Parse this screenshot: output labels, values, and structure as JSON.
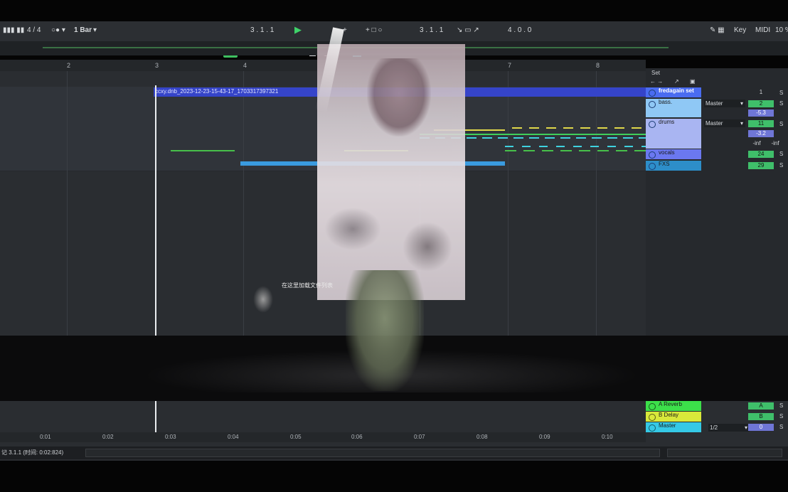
{
  "transport": {
    "time_sig": "4 / 4",
    "quantize": "1 Bar",
    "position": "3 . 1 . 1",
    "loop_start": "3 . 1 . 1",
    "loop_length": "4 . 0 . 0",
    "key_label": "Key",
    "midi_label": "MIDI",
    "cpu": "10 %"
  },
  "ruler": {
    "bars": [
      "2",
      "3",
      "4",
      "7",
      "8"
    ]
  },
  "clip": {
    "name": "ccxy.dnb_2023-12-23-15-43-17_1703317397321"
  },
  "set_label": "Set",
  "tracks": [
    {
      "name": "fredagain set",
      "color": "#4a6cf0",
      "vol": "1",
      "solo": "S"
    },
    {
      "name": "bass.",
      "color": "#8fc8f5",
      "vol": "2",
      "extra": "-5.3",
      "route": "Master",
      "solo": "S"
    },
    {
      "name": "drums",
      "color": "#a9b5f2",
      "vol": "11",
      "extra": "-3.2",
      "route": "Master",
      "solo": "S",
      "inf1": "-inf",
      "inf2": "-inf"
    },
    {
      "name": "vocals",
      "color": "#6b78f0",
      "vol": "24",
      "solo": "S"
    },
    {
      "name": "FXS",
      "color": "#2d8ec9",
      "vol": "29",
      "solo": "S"
    }
  ],
  "returns": [
    {
      "name": "A Reverb",
      "color": "#3ce04a",
      "send": "A",
      "solo": "S"
    },
    {
      "name": "B Delay",
      "color": "#d8e83a",
      "send": "B",
      "solo": "S"
    },
    {
      "name": "Master",
      "color": "#35c9e6",
      "route": "1/2",
      "send": "0",
      "solo": "S"
    }
  ],
  "timeline": [
    "0:01",
    "0:02",
    "0:03",
    "0:04",
    "0:05",
    "0:06",
    "0:07",
    "0:08",
    "0:09",
    "0:10"
  ],
  "status": "记 3.1.1 (时间:  0:02:824)",
  "subtitle": "在这里加载文件列表"
}
